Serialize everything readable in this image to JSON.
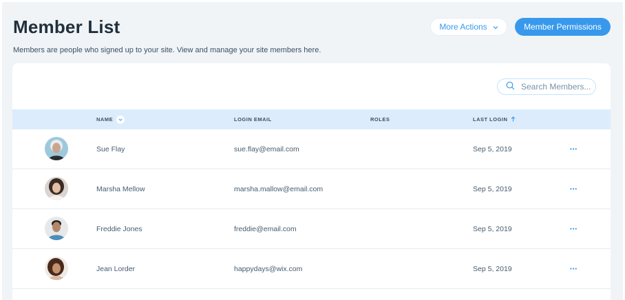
{
  "header": {
    "title": "Member List",
    "subtitle": "Members are people who signed up to your site. View and manage your site members here.",
    "more_actions_label": "More Actions",
    "permissions_label": "Member Permissions"
  },
  "search": {
    "placeholder": "Search Members..."
  },
  "table": {
    "columns": {
      "name": "NAME",
      "email": "LOGIN EMAIL",
      "roles": "ROLES",
      "last_login": "LAST LOGIN"
    },
    "rows": [
      {
        "name": "Sue Flay",
        "email": "sue.flay@email.com",
        "roles": "",
        "last_login": "Sep 5, 2019"
      },
      {
        "name": "Marsha Mellow",
        "email": "marsha.mallow@email.com",
        "roles": "",
        "last_login": "Sep 5, 2019"
      },
      {
        "name": "Freddie Jones",
        "email": "freddie@email.com",
        "roles": "",
        "last_login": "Sep 5, 2019"
      },
      {
        "name": "Jean Lorder",
        "email": "happydays@wix.com",
        "roles": "",
        "last_login": "Sep 5, 2019"
      }
    ]
  },
  "icons": {
    "more_actions_chevron": "chevron-down-icon",
    "search": "search-icon",
    "name_sort": "chevron-down-icon",
    "last_login_sort": "arrow-up-icon",
    "row_menu": "more-horizontal-icon"
  },
  "colors": {
    "accent": "#3899ec",
    "header_row": "#dcecfc",
    "page_background": "#f0f4f7",
    "title": "#20303c"
  }
}
